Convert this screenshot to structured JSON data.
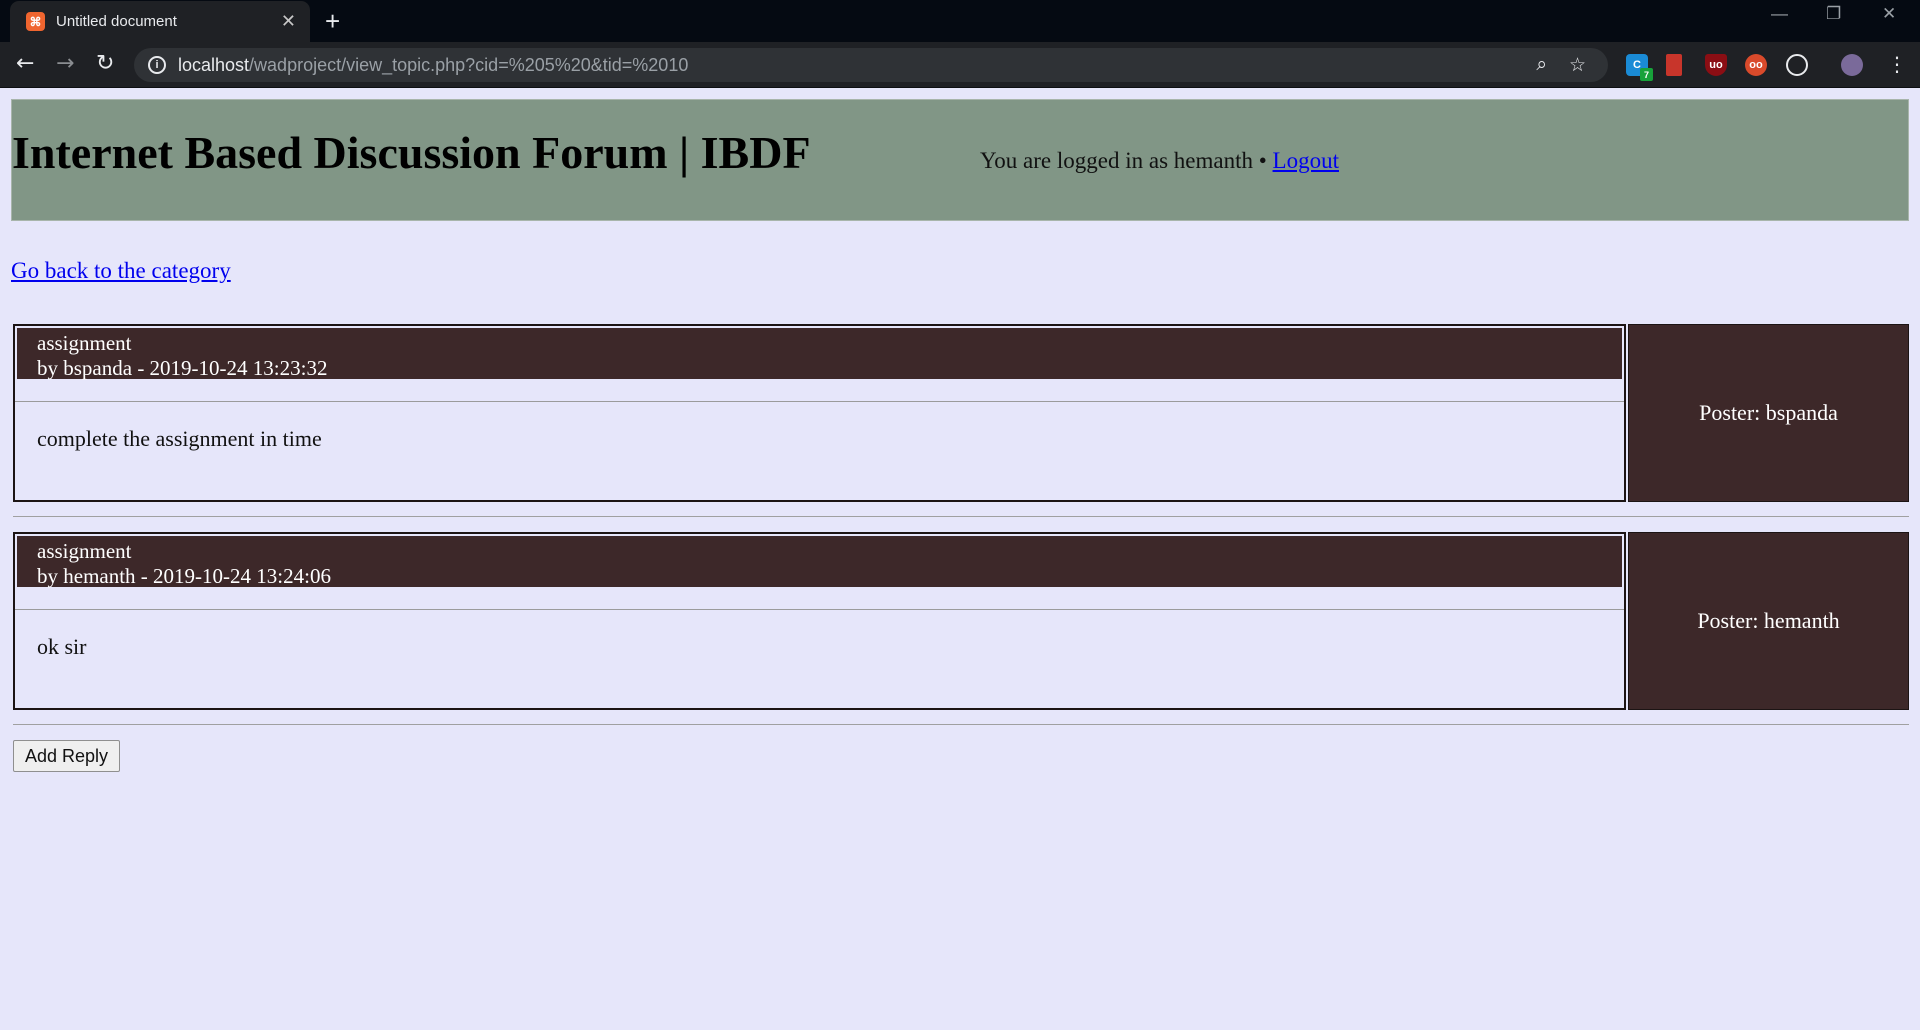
{
  "browser": {
    "tab_title": "Untitled document",
    "url_host": "localhost",
    "url_path": "/wadproject/view_topic.php?cid=%205%20&tid=%2010",
    "extension_badge": "7"
  },
  "header": {
    "site_title": "Internet Based Discussion Forum | IBDF",
    "login_text": "You are logged in as hemanth • ",
    "logout_label": "Logout"
  },
  "nav": {
    "back_link": "Go back to the category"
  },
  "posts": [
    {
      "subject": "assignment",
      "byline": "by bspanda - 2019-10-24 13:23:32",
      "body": "complete the assignment in time",
      "poster": "Poster: bspanda"
    },
    {
      "subject": "assignment",
      "byline": "by hemanth - 2019-10-24 13:24:06",
      "body": "ok sir",
      "poster": "Poster: hemanth"
    }
  ],
  "actions": {
    "add_reply_label": "Add Reply"
  }
}
